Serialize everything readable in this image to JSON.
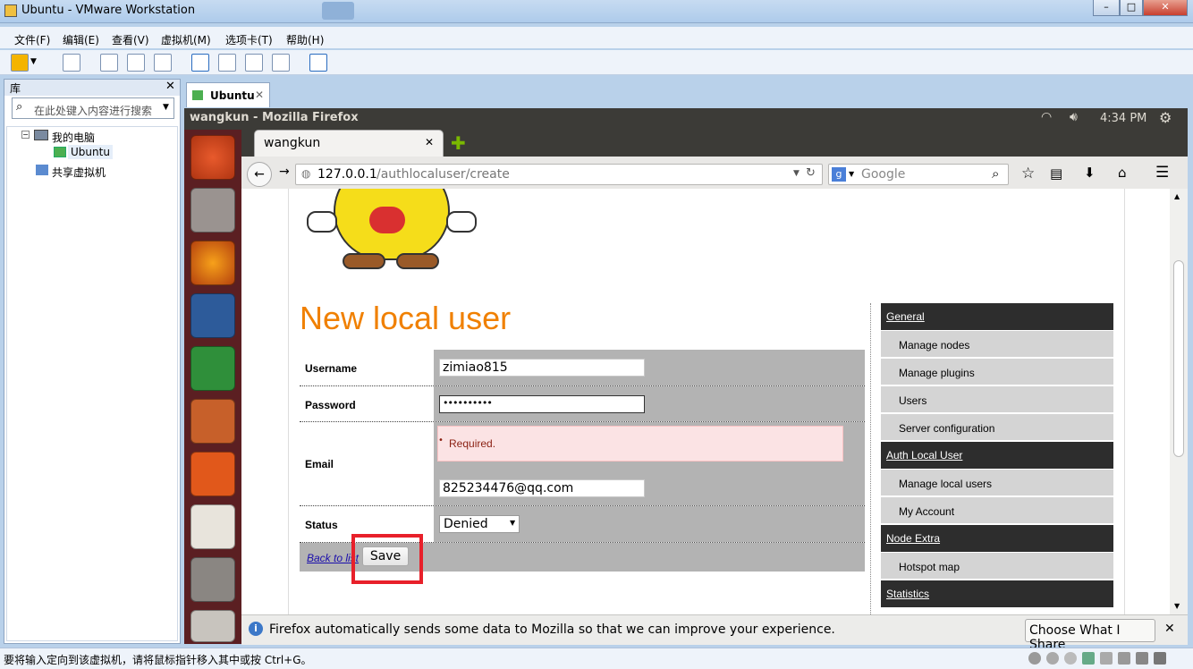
{
  "vmware": {
    "title": "Ubuntu - VMware Workstation",
    "menu": [
      "文件(F)",
      "编辑(E)",
      "查看(V)",
      "虚拟机(M)",
      "选项卡(T)",
      "帮助(H)"
    ],
    "library_title": "库",
    "search_placeholder": "在此处键入内容进行搜索",
    "tree": {
      "my_computer": "我的电脑",
      "vm": "Ubuntu",
      "shared": "共享虚拟机"
    },
    "vm_tab": "Ubuntu",
    "status_text": "要将输入定向到该虚拟机，请将鼠标指针移入其中或按 Ctrl+G。"
  },
  "ubuntu": {
    "window_title": "wangkun - Mozilla Firefox",
    "clock": "4:34 PM"
  },
  "firefox": {
    "tab_title": "wangkun",
    "url_host": "127.0.0.1",
    "url_path": "/authlocaluser/create",
    "search_engine_placeholder": "Google",
    "notification": "Firefox automatically sends some data to Mozilla so that we can improve your experience.",
    "notification_button": "Choose What I Share"
  },
  "page": {
    "heading": "New local user",
    "form": {
      "username_label": "Username",
      "username_value": "zimiao815",
      "password_label": "Password",
      "password_value": "••••••••••",
      "email_label": "Email",
      "email_error": "Required.",
      "email_value": "825234476@qq.com",
      "status_label": "Status",
      "status_value": "Denied",
      "back_link": "Back to list",
      "save_button": "Save"
    },
    "sidebar": [
      {
        "header": "General",
        "items": [
          "Manage nodes",
          "Manage plugins",
          "Users",
          "Server configuration"
        ]
      },
      {
        "header": "Auth Local User",
        "items": [
          "Manage local users",
          "My Account"
        ]
      },
      {
        "header": "Node Extra",
        "items": [
          "Hotspot map"
        ]
      },
      {
        "header": "Statistics",
        "items": []
      }
    ]
  },
  "colors": {
    "heading": "#f08000",
    "highlight_box": "#e8202a",
    "error_bg": "#fbe3e4",
    "launcher_bg": "#5b1f22"
  }
}
